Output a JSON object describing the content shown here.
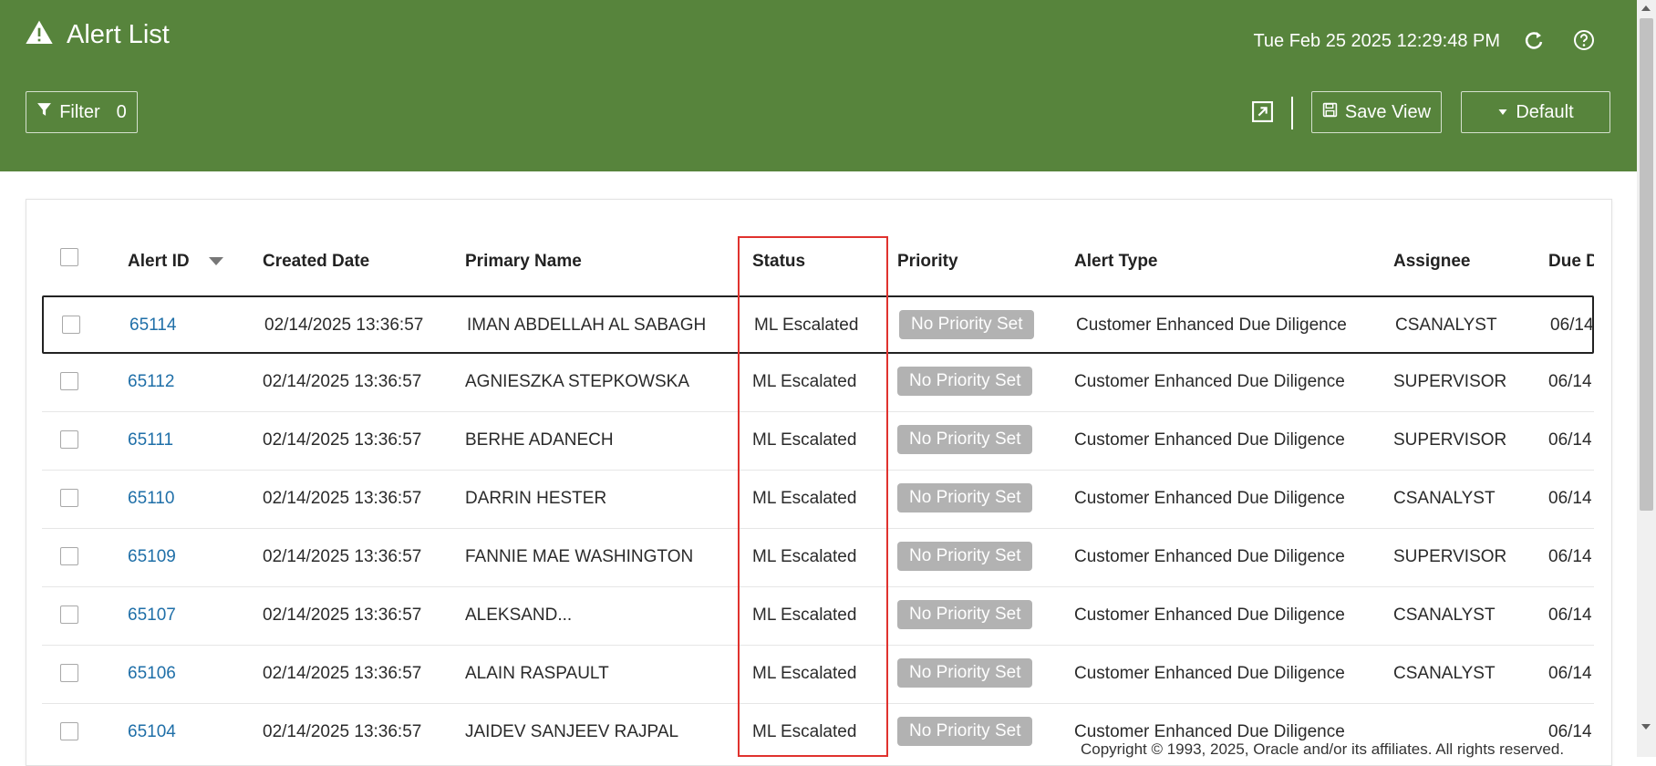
{
  "header": {
    "title": "Alert List",
    "datetime": "Tue Feb 25 2025 12:29:48 PM",
    "filter_label": "Filter",
    "filter_count": "0",
    "save_view_label": "Save View",
    "default_label": "Default",
    "icons": [
      "warning-icon",
      "refresh-icon",
      "help-icon",
      "expand-icon",
      "filter-icon",
      "save-icon",
      "caret-down-icon"
    ]
  },
  "table": {
    "columns": [
      "Alert ID",
      "Created Date",
      "Primary Name",
      "Status",
      "Priority",
      "Alert Type",
      "Assignee",
      "Due D"
    ],
    "rows": [
      {
        "id": "65114",
        "created": "02/14/2025 13:36:57",
        "name": "IMAN ABDELLAH AL SABAGH",
        "status": "ML Escalated",
        "priority": "No Priority Set",
        "type": "Customer Enhanced Due Diligence",
        "assignee": "CSANALYST",
        "due": "06/14"
      },
      {
        "id": "65112",
        "created": "02/14/2025 13:36:57",
        "name": "AGNIESZKA STEPKOWSKA",
        "status": "ML Escalated",
        "priority": "No Priority Set",
        "type": "Customer Enhanced Due Diligence",
        "assignee": "SUPERVISOR",
        "due": "06/14"
      },
      {
        "id": "65111",
        "created": "02/14/2025 13:36:57",
        "name": "BERHE ADANECH",
        "status": "ML Escalated",
        "priority": "No Priority Set",
        "type": "Customer Enhanced Due Diligence",
        "assignee": "SUPERVISOR",
        "due": "06/14"
      },
      {
        "id": "65110",
        "created": "02/14/2025 13:36:57",
        "name": "DARRIN HESTER",
        "status": "ML Escalated",
        "priority": "No Priority Set",
        "type": "Customer Enhanced Due Diligence",
        "assignee": "CSANALYST",
        "due": "06/14"
      },
      {
        "id": "65109",
        "created": "02/14/2025 13:36:57",
        "name": "FANNIE MAE WASHINGTON",
        "status": "ML Escalated",
        "priority": "No Priority Set",
        "type": "Customer Enhanced Due Diligence",
        "assignee": "SUPERVISOR",
        "due": "06/14"
      },
      {
        "id": "65107",
        "created": "02/14/2025 13:36:57",
        "name": "ALEKSAND...",
        "status": "ML Escalated",
        "priority": "No Priority Set",
        "type": "Customer Enhanced Due Diligence",
        "assignee": "CSANALYST",
        "due": "06/14"
      },
      {
        "id": "65106",
        "created": "02/14/2025 13:36:57",
        "name": "ALAIN RASPAULT",
        "status": "ML Escalated",
        "priority": "No Priority Set",
        "type": "Customer Enhanced Due Diligence",
        "assignee": "CSANALYST",
        "due": "06/14"
      },
      {
        "id": "65104",
        "created": "02/14/2025 13:36:57",
        "name": "JAIDEV SANJEEV RAJPAL",
        "status": "ML Escalated",
        "priority": "No Priority Set",
        "type": "Customer Enhanced Due Diligence",
        "assignee": "",
        "due": "06/14"
      }
    ]
  },
  "colors": {
    "header_bg": "#57843c",
    "link": "#1f6fa8",
    "badge_bg": "#b2b2b2",
    "highlight": "#e0322e"
  },
  "footer": {
    "text": "Copyright © 1993, 2025, Oracle and/or its affiliates. All rights reserved."
  }
}
